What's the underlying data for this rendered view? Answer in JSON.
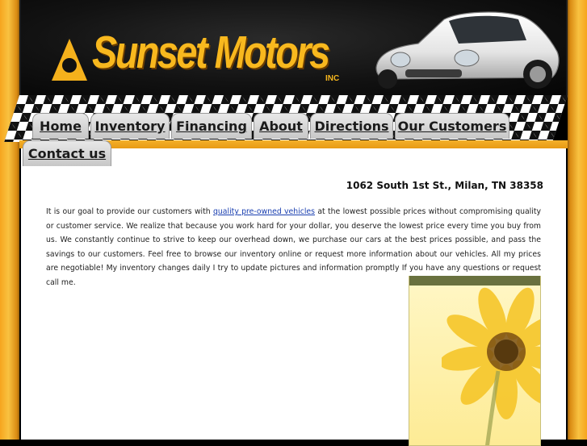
{
  "brand": {
    "name": "Sunset Motors",
    "suffix": "INC"
  },
  "nav": [
    {
      "id": "home",
      "label": "Home"
    },
    {
      "id": "inventory",
      "label": "Inventory"
    },
    {
      "id": "financing",
      "label": "Financing"
    },
    {
      "id": "about",
      "label": "About"
    },
    {
      "id": "directions",
      "label": "Directions"
    },
    {
      "id": "our-customers",
      "label": "Our Customers"
    },
    {
      "id": "contact-us",
      "label": "Contact us"
    }
  ],
  "content": {
    "address": "1062 South 1st St., Milan, TN 38358",
    "intro_before": "It is our goal to provide our customers with ",
    "intro_link": "quality pre-owned vehicles",
    "intro_after": " at the lowest possible prices without compromising quality or customer service. We realize that because you work hard for your dollar, you deserve the lowest price every time you buy from us. We constantly continue to strive to keep our overhead down, we purchase our cars at the best prices possible, and pass the savings to our customers. Feel free to browse our inventory online or request more information about our vehicles. All my prices are negotiable! My inventory changes daily I try to update pictures and information promptly If you have any questions or request call me."
  },
  "colors": {
    "accent_orange": "#f8b81e",
    "nav_bar": "#f4b02a",
    "tab_bg": "#d9d9d9",
    "link": "#1a3fb0",
    "sidebox_header": "#69713f"
  },
  "icons": {
    "logo": "sunset-logo-icon",
    "car": "sports-car-image",
    "flower": "sunflower-image"
  }
}
